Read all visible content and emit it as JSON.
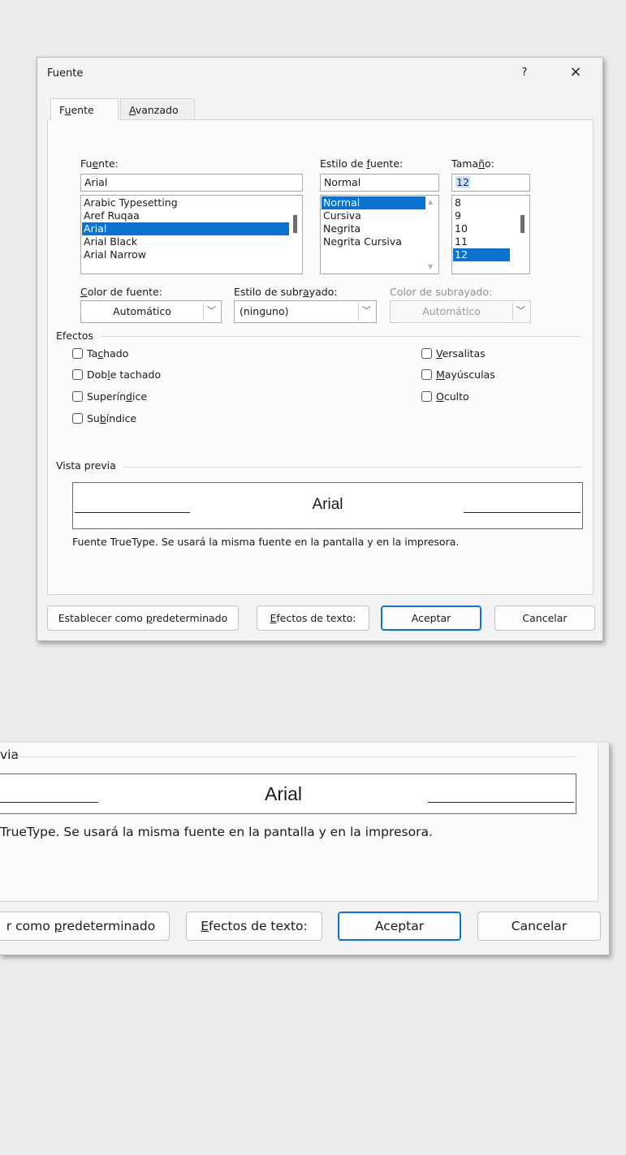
{
  "dialog": {
    "title": "Fuente",
    "help": "?",
    "close": "×"
  },
  "tabs": {
    "font": {
      "pre": "F",
      "key": "u",
      "post": "ente"
    },
    "advanced": {
      "pre": "",
      "key": "A",
      "post": "vanzado"
    }
  },
  "font": {
    "label": {
      "pre": "Fu",
      "key": "e",
      "post": "nte:"
    },
    "value": "Arial",
    "list": [
      "Arabic Typesetting",
      "Aref Ruqaa",
      "Arial",
      "Arial Black",
      "Arial Narrow"
    ],
    "selected": "Arial"
  },
  "style": {
    "label": {
      "pre": "Estilo de ",
      "key": "f",
      "post": "uente:"
    },
    "value": "Normal",
    "list": [
      "Normal",
      "Cursiva",
      "Negrita",
      "Negrita Cursiva"
    ],
    "selected": "Normal"
  },
  "size": {
    "label": {
      "pre": "Tama",
      "key": "ñ",
      "post": "o:"
    },
    "value": "12",
    "list": [
      "8",
      "9",
      "10",
      "11",
      "12"
    ],
    "selected": "12"
  },
  "font_color": {
    "label": {
      "pre": "",
      "key": "C",
      "post": "olor de fuente:"
    },
    "value": "Automático"
  },
  "underline_style": {
    "label": {
      "pre": "Estilo de subr",
      "key": "a",
      "post": "yado:"
    },
    "value": "(ninguno)"
  },
  "underline_color": {
    "label": "Color de subrayado:",
    "value": "Automático"
  },
  "effects": {
    "title": "Efectos",
    "strikethrough": {
      "pre": "Ta",
      "key": "c",
      "post": "hado"
    },
    "double_strikethrough": {
      "pre": "Dob",
      "key": "l",
      "post": "e tachado"
    },
    "superscript": {
      "pre": "Superín",
      "key": "d",
      "post": "ice"
    },
    "subscript": {
      "pre": "Su",
      "key": "b",
      "post": "índice"
    },
    "small_caps": {
      "pre": "",
      "key": "V",
      "post": "ersalitas"
    },
    "all_caps": {
      "pre": "",
      "key": "M",
      "post": "ayúsculas"
    },
    "hidden": {
      "pre": "",
      "key": "O",
      "post": "culto"
    }
  },
  "preview": {
    "title": "Vista previa",
    "sample": "Arial",
    "note": "Fuente TrueType. Se usará la misma fuente en la pantalla y en la impresora."
  },
  "buttons": {
    "default": {
      "pre": "Establecer como ",
      "key": "p",
      "post": "redeterminado"
    },
    "text_effects": {
      "pre": "",
      "key": "E",
      "post": "fectos de texto:"
    },
    "ok": "Aceptar",
    "cancel": "Cancelar"
  },
  "zoom": {
    "preview_title_fragment": "via",
    "note_fragment": "TrueType. Se usará la misma fuente en la pantalla y en la impresora.",
    "default_btn": {
      "pre": "r como ",
      "key": "p",
      "post": "redeterminado"
    }
  }
}
